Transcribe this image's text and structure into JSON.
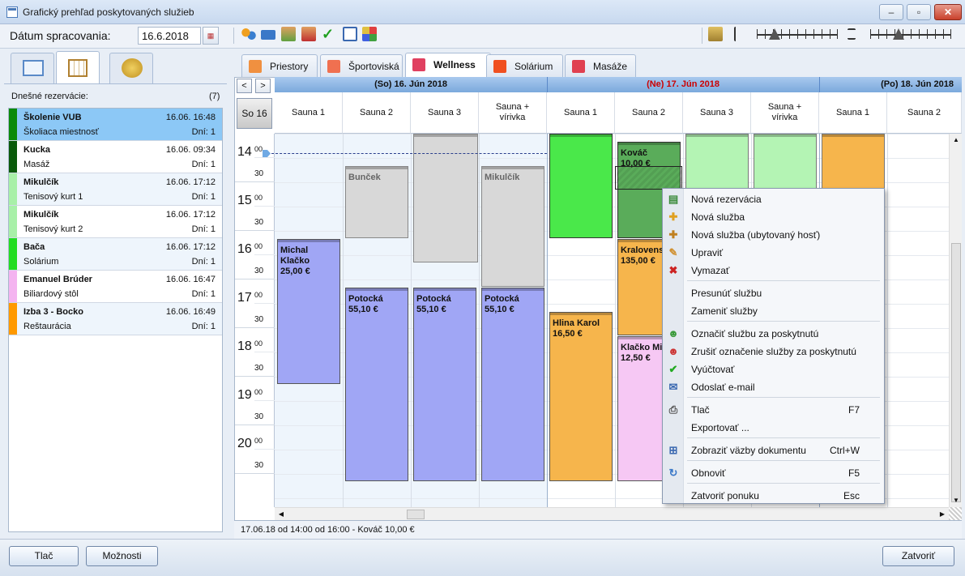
{
  "window": {
    "title": "Grafický prehľad poskytovaných služieb"
  },
  "toolbar": {
    "date_label": "Dátum spracovania:",
    "date_value": "16.6.2018"
  },
  "left": {
    "today_label": "Dnešné rezervácie:",
    "today_count": "(7)",
    "reservations": [
      {
        "name": "Školenie VUB",
        "datetime": "16.06. 16:48",
        "place": "Školiaca miestnosť",
        "days": "Dní: 1",
        "color": "#0a8a0a",
        "bg": "#8cc8f6"
      },
      {
        "name": "Kucka",
        "datetime": "16.06. 09:34",
        "place": "Masáž",
        "days": "Dní: 1",
        "color": "#0a5a0a",
        "bg": "#ffffff"
      },
      {
        "name": "Mikulčík",
        "datetime": "16.06. 17:12",
        "place": "Tenisový kurt 1",
        "days": "Dní: 1",
        "color": "#a8f0a8",
        "bg": "#eef5fc"
      },
      {
        "name": "Mikulčík",
        "datetime": "16.06. 17:12",
        "place": "Tenisový kurt 2",
        "days": "Dní: 1",
        "color": "#a8f0a8",
        "bg": "#ffffff"
      },
      {
        "name": "Bača",
        "datetime": "16.06. 17:12",
        "place": "Solárium",
        "days": "Dní: 1",
        "color": "#22dd22",
        "bg": "#eef5fc"
      },
      {
        "name": "Emanuel Brúder",
        "datetime": "16.06. 16:47",
        "place": "Biliardový stôl",
        "days": "Dní: 1",
        "color": "#f4b4f0",
        "bg": "#ffffff"
      },
      {
        "name": "Izba 3 - Bocko",
        "datetime": "16.06. 16:49",
        "place": "Reštaurácia",
        "days": "Dní: 1",
        "color": "#ff9900",
        "bg": "#eef5fc"
      }
    ]
  },
  "tabs": [
    {
      "label": "Priestory",
      "icon": "building-icon",
      "color": "#f09040"
    },
    {
      "label": "Športoviská",
      "icon": "sport-icon",
      "color": "#f07050"
    },
    {
      "label": "Wellness",
      "icon": "wellness-icon",
      "color": "#e04060"
    },
    {
      "label": "Solárium",
      "icon": "sun-icon",
      "color": "#f05020"
    },
    {
      "label": "Masáže",
      "icon": "massage-icon",
      "color": "#e04050"
    }
  ],
  "calendar": {
    "today_button": "So 16",
    "days": [
      {
        "label": "(So) 16. Jún 2018",
        "color": "#111111"
      },
      {
        "label": "(Ne) 17. Jún 2018",
        "color": "#cc0000"
      },
      {
        "label": "(Po) 18. Jún 2018",
        "color": "#111111"
      }
    ],
    "columns": [
      "Sauna 1",
      "Sauna 2",
      "Sauna 3",
      "Sauna + vírivka",
      "Sauna 1",
      "Sauna 2",
      "Sauna 3",
      "Sauna + vírivka",
      "Sauna 1",
      "Sauna 2"
    ],
    "hours": [
      "14",
      "15",
      "16",
      "17",
      "18",
      "19",
      "20"
    ],
    "min00": "00",
    "min30": "30",
    "events": {
      "e1": {
        "name": "Michal Klačko",
        "price": "25,00 €"
      },
      "e2": {
        "name": "Bunček"
      },
      "e3": {
        "name": "Mikulčík"
      },
      "e4": {
        "name": "Potocká",
        "price": "55,10 €"
      },
      "e5": {
        "name": "Potocká",
        "price": "55,10 €"
      },
      "e6": {
        "name": "Potocká",
        "price": "55,10 €"
      },
      "e7": {
        "name": "Hlina Karol",
        "price": "16,50 €"
      },
      "e8": {
        "name": "Kováč",
        "price": "10,00 €"
      },
      "e9": {
        "name": "Kralovens",
        "price": "135,00 €"
      },
      "e10": {
        "name": "Klačko Mi",
        "price": "12,50 €"
      }
    }
  },
  "status": "17.06.18  od 14:00  od 16:00  -  Kováč   10,00 €",
  "menu": [
    {
      "label": "Nová rezervácia",
      "shortcut": "",
      "icon": "new-reservation-icon"
    },
    {
      "label": "Nová služba",
      "shortcut": "",
      "icon": "plus-icon"
    },
    {
      "label": "Nová služba (ubytovaný hosť)",
      "shortcut": "",
      "icon": "plus-guest-icon"
    },
    {
      "label": "Upraviť",
      "shortcut": "",
      "icon": "pencil-icon"
    },
    {
      "label": "Vymazať",
      "shortcut": "",
      "icon": "delete-icon"
    },
    {
      "label": "Presunúť službu",
      "shortcut": ""
    },
    {
      "label": "Zameniť služby",
      "shortcut": ""
    },
    {
      "label": "Označiť službu za poskytnutú",
      "shortcut": "",
      "icon": "mark-done-icon"
    },
    {
      "label": "Zrušiť označenie služby za poskytnutú",
      "shortcut": "",
      "icon": "unmark-done-icon"
    },
    {
      "label": "Vyúčtovať",
      "shortcut": "",
      "icon": "check-icon"
    },
    {
      "label": "Odoslať e-mail",
      "shortcut": "",
      "icon": "email-icon"
    },
    {
      "label": "Tlač",
      "shortcut": "F7",
      "icon": "print-icon"
    },
    {
      "label": "Exportovať ...",
      "shortcut": ""
    },
    {
      "label": "Zobraziť väzby dokumentu",
      "shortcut": "Ctrl+W",
      "icon": "links-icon"
    },
    {
      "label": "Obnoviť",
      "shortcut": "F5",
      "icon": "refresh-icon"
    },
    {
      "label": "Zatvoriť ponuku",
      "shortcut": "Esc"
    }
  ],
  "buttons": {
    "print": "Tlač",
    "options": "Možnosti",
    "close": "Zatvoriť"
  }
}
